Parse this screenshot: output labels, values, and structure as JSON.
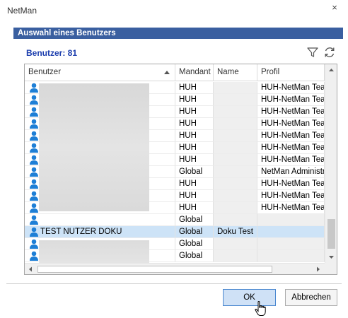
{
  "window": {
    "title": "NetMan",
    "close_glyph": "×"
  },
  "section_title": "Auswahl eines Benutzers",
  "user_count_label": "Benutzer: 81",
  "toolbar": {
    "filter_icon": "filter-icon",
    "refresh_icon": "refresh-icon"
  },
  "table": {
    "columns": [
      "Benutzer",
      "Mandant",
      "Name",
      "Profil"
    ],
    "sorted_column": "Benutzer",
    "rows": [
      {
        "benutzer": "",
        "mandant": "HUH",
        "name": "",
        "profil": "HUH-NetMan Teach"
      },
      {
        "benutzer": "",
        "mandant": "HUH",
        "name": "",
        "profil": "HUH-NetMan Teach"
      },
      {
        "benutzer": "",
        "mandant": "HUH",
        "name": "",
        "profil": "HUH-NetMan Teach"
      },
      {
        "benutzer": "",
        "mandant": "HUH",
        "name": "",
        "profil": "HUH-NetMan Teach"
      },
      {
        "benutzer": "",
        "mandant": "HUH",
        "name": "",
        "profil": "HUH-NetMan Teach"
      },
      {
        "benutzer": "",
        "mandant": "HUH",
        "name": "",
        "profil": "HUH-NetMan Teach"
      },
      {
        "benutzer": "",
        "mandant": "HUH",
        "name": "",
        "profil": "HUH-NetMan Teach"
      },
      {
        "benutzer": "",
        "mandant": "Global",
        "name": "",
        "profil": "NetMan Administra"
      },
      {
        "benutzer": "",
        "mandant": "HUH",
        "name": "",
        "profil": "HUH-NetMan Teach"
      },
      {
        "benutzer": "",
        "mandant": "HUH",
        "name": "",
        "profil": "HUH-NetMan Teach"
      },
      {
        "benutzer": "",
        "mandant": "HUH",
        "name": "",
        "profil": "HUH-NetMan Teach"
      },
      {
        "benutzer": "",
        "mandant": "Global",
        "name": "",
        "profil": ""
      },
      {
        "benutzer": "TEST NUTZER DOKU",
        "mandant": "Global",
        "name": "Doku Test",
        "profil": "",
        "selected": true
      },
      {
        "benutzer": "",
        "mandant": "Global",
        "name": "",
        "profil": ""
      },
      {
        "benutzer": "",
        "mandant": "Global",
        "name": "",
        "profil": ""
      }
    ]
  },
  "buttons": {
    "ok": "OK",
    "cancel": "Abbrechen"
  },
  "colors": {
    "header_bar": "#3a5fa0",
    "count_text": "#1d3fae",
    "selection": "#cde3f7",
    "user_icon": "#1e7fd6"
  }
}
